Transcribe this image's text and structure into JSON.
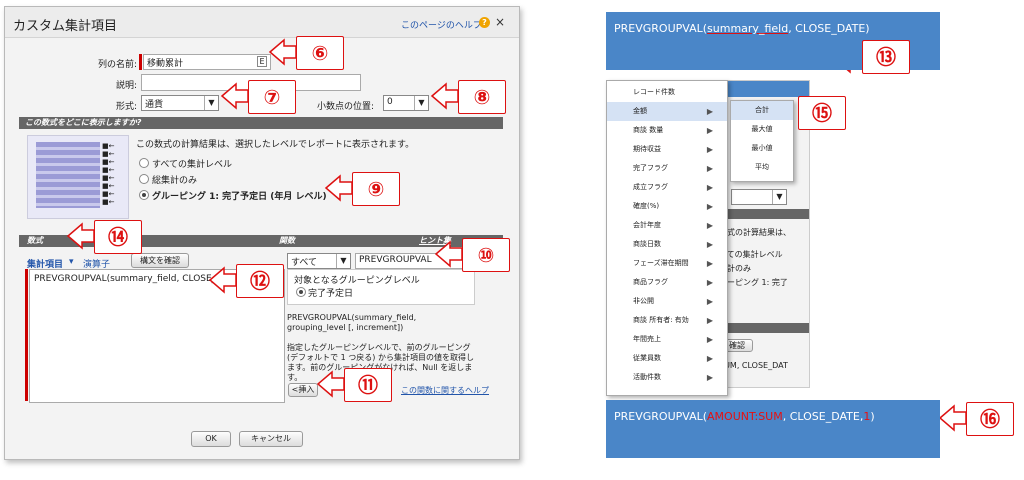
{
  "dialog": {
    "title": "カスタム集計項目",
    "help_link": "このページのヘルプ",
    "help_icon": "?",
    "close_icon": "×",
    "fields": {
      "column_name_label": "列の名前:",
      "column_name_value": "移動累計",
      "description_label": "説明:",
      "format_label": "形式:",
      "format_value": "通貨",
      "decimal_label": "小数点の位置:",
      "decimal_value": "0"
    },
    "display_section": {
      "header": "この数式をどこに表示しますか?",
      "note": "この数式の計算結果は、選択したレベルでレポートに表示されます。",
      "options": [
        "すべての集計レベル",
        "総集計のみ",
        "グルーピング 1: 完了予定日 (年月 レベル)"
      ]
    },
    "formula_section": {
      "col_formula": "数式",
      "col_function": "関数",
      "col_hint": "ヒント集",
      "summary_fields_link": "集計項目",
      "operator_link": "演算子",
      "check_syntax_button": "構文を確認",
      "formula_text": "PREVGROUPVAL(summary_field, CLOSE_DATE",
      "function_filter": "すべて",
      "function_selected": "PREVGROUPVAL",
      "group_level_title": "対象となるグルーピングレベル",
      "group_level_option": "完了予定日",
      "syntax": "PREVGROUPVAL(summary_field, grouping_level [, increment])",
      "description": "指定したグルーピングレベルで、前のグルーピング (デフォルトで 1 つ戻る) から集計項目の値を取得します。前のグルーピングがなければ、Null を返します。",
      "insert_button": "<挿入",
      "function_help_link": "この関数に関するヘルプ"
    },
    "ok_button": "OK",
    "cancel_button": "キャンセル"
  },
  "callouts": {
    "c6": "⑥",
    "c7": "⑦",
    "c8": "⑧",
    "c9": "⑨",
    "c10": "⑩",
    "c11": "⑪",
    "c12": "⑫",
    "c13": "⑬",
    "c14": "⑭",
    "c15": "⑮",
    "c16": "⑯"
  },
  "right": {
    "top_formula_prefix": "PREVGROUPVAL(",
    "top_formula_field": "summary_field",
    "top_formula_suffix": ", CLOSE_DATE)",
    "menu_items": [
      "レコード件数",
      "金額",
      "商談 数量",
      "期待収益",
      "完了フラグ",
      "成立フラグ",
      "確度(%)",
      "会計年度",
      "商談日数",
      "フェーズ滞在期間",
      "商品フラグ",
      "非公開",
      "商談 所有者: 有効",
      "年間売上",
      "従業員数",
      "活動件数"
    ],
    "submenu_items": [
      "合計",
      "最大値",
      "最小値",
      "平均"
    ],
    "behind_texts": [
      "数式の計算結果は、",
      "べての集計レベル",
      "集計のみ",
      "ルーピング 1: 完了",
      "SUM, CLOSE_DAT"
    ],
    "behind_button": "確認",
    "bottom_formula_prefix": "PREVGROUPVAL(",
    "bottom_formula_amount": "AMOUNT:SUM",
    "bottom_formula_mid": ", CLOSE_DATE,",
    "bottom_formula_one": "1",
    "bottom_formula_end": ")"
  },
  "colors": {
    "callout_red": "#dd1111",
    "box_blue": "#4a86c8",
    "section_bar": "#666666"
  }
}
